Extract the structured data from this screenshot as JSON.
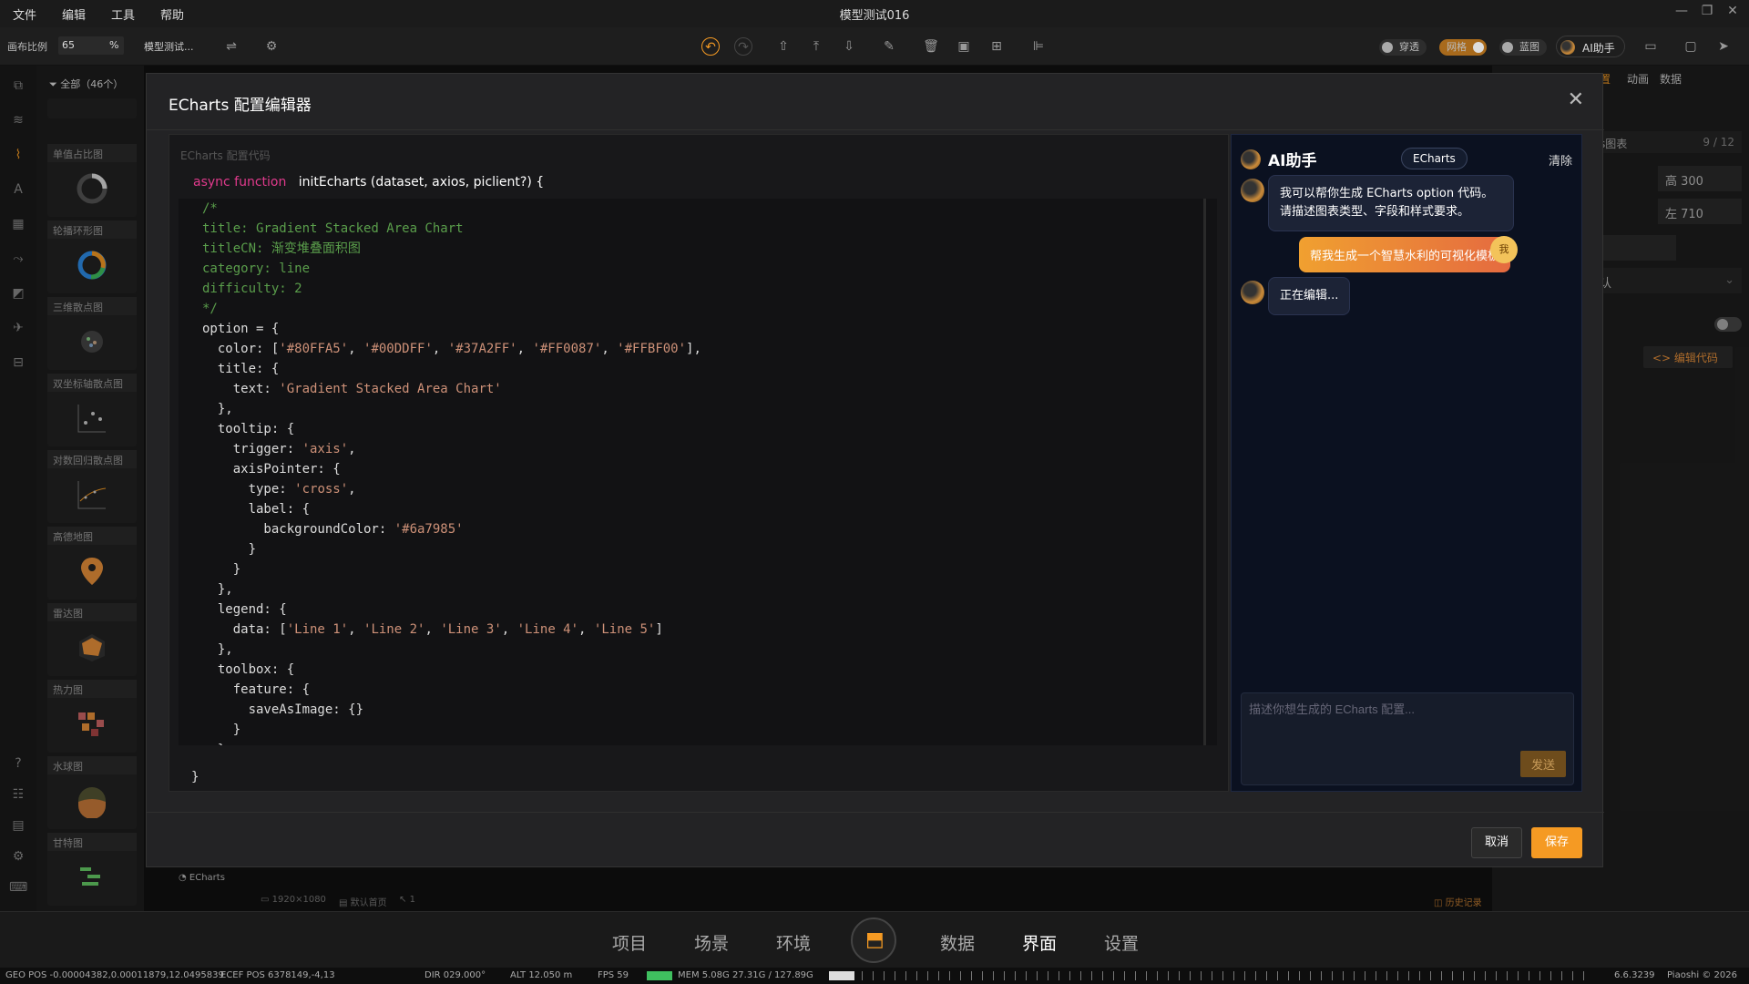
{
  "menu": {
    "file": "文件",
    "edit": "编辑",
    "tools": "工具",
    "help": "帮助"
  },
  "window_title": "模型测试016",
  "toolbar": {
    "scale_label": "画布比例",
    "scale_value": "65",
    "scale_unit": "%",
    "project_name": "模型测试...",
    "toggle_through": "穿透",
    "toggle_grid": "网格",
    "toggle_blueprint": "蓝图",
    "ai_button": "AI助手"
  },
  "palette": {
    "filter_label": "全部（46个）",
    "items": [
      {
        "label": "单值占比图"
      },
      {
        "label": "轮播环形图"
      },
      {
        "label": "三维散点图"
      },
      {
        "label": "双坐标轴散点图"
      },
      {
        "label": "对数回归散点图"
      },
      {
        "label": "高德地图"
      },
      {
        "label": "雷达图"
      },
      {
        "label": "热力图"
      },
      {
        "label": "水球图"
      },
      {
        "label": "甘特图"
      }
    ]
  },
  "canvas": {
    "badge": "ECharts",
    "size": "1920×1080",
    "page": "默认首页",
    "count": "1",
    "history": "历史记录"
  },
  "right_panel": {
    "tabs": [
      "置",
      "动画",
      "数据"
    ],
    "chart_name": "s图表",
    "page_index": "9 / 12",
    "height": "高 300",
    "left": "左 710",
    "select": "认",
    "edit_code": "<> 编辑代码"
  },
  "bottom_nav": [
    "项目",
    "场景",
    "环境",
    "数据",
    "界面",
    "设置"
  ],
  "status": {
    "geo_pos": "GEO POS  -0.00004382,0.00011879,12.0495839",
    "ecef_pos": "ECEF POS  6378149,-4,13",
    "dir": "DIR  029.000°",
    "alt": "ALT  12.050 m",
    "fps": "FPS  59",
    "mem": "MEM  5.08G  27.31G / 127.89G",
    "version": "6.6.3239",
    "copyright": "Piaoshi © 2026"
  },
  "modal": {
    "title": "ECharts 配置编辑器",
    "code_header": "ECharts 配置代码",
    "fn_keyword": "async function",
    "fn_signature": "initEcharts (dataset, axios, piclient?) {",
    "close_brace": "}",
    "cancel": "取消",
    "save": "保存"
  },
  "code_lines": [
    "/*",
    "title: Gradient Stacked Area Chart",
    "titleCN: 渐变堆叠面积图",
    "category: line",
    "difficulty: 2",
    "*/",
    "option = {",
    "  color: ['#80FFA5', '#00DDFF', '#37A2FF', '#FF0087', '#FFBF00'],",
    "  title: {",
    "    text: 'Gradient Stacked Area Chart'",
    "  },",
    "  tooltip: {",
    "    trigger: 'axis',",
    "    axisPointer: {",
    "      type: 'cross',",
    "      label: {",
    "        backgroundColor: '#6a7985'",
    "      }",
    "    }",
    "  },",
    "  legend: {",
    "    data: ['Line 1', 'Line 2', 'Line 3', 'Line 4', 'Line 5']",
    "  },",
    "  toolbox: {",
    "    feature: {",
    "      saveAsImage: {}",
    "    }",
    "  },"
  ],
  "ai": {
    "title": "AI助手",
    "chip": "ECharts",
    "clear": "清除",
    "msg1": "我可以帮你生成 ECharts option 代码。请描述图表类型、字段和样式要求。",
    "user_msg": "帮我生成一个智慧水利的可视化模板",
    "me": "我",
    "msg2": "正在编辑...",
    "placeholder": "描述你想生成的 ECharts 配置...",
    "send": "发送"
  },
  "colors": {
    "accent": "#f59a23",
    "code_comment": "#5a9e4b",
    "code_string": "#ce9178",
    "keyword": "#e03a8c"
  }
}
